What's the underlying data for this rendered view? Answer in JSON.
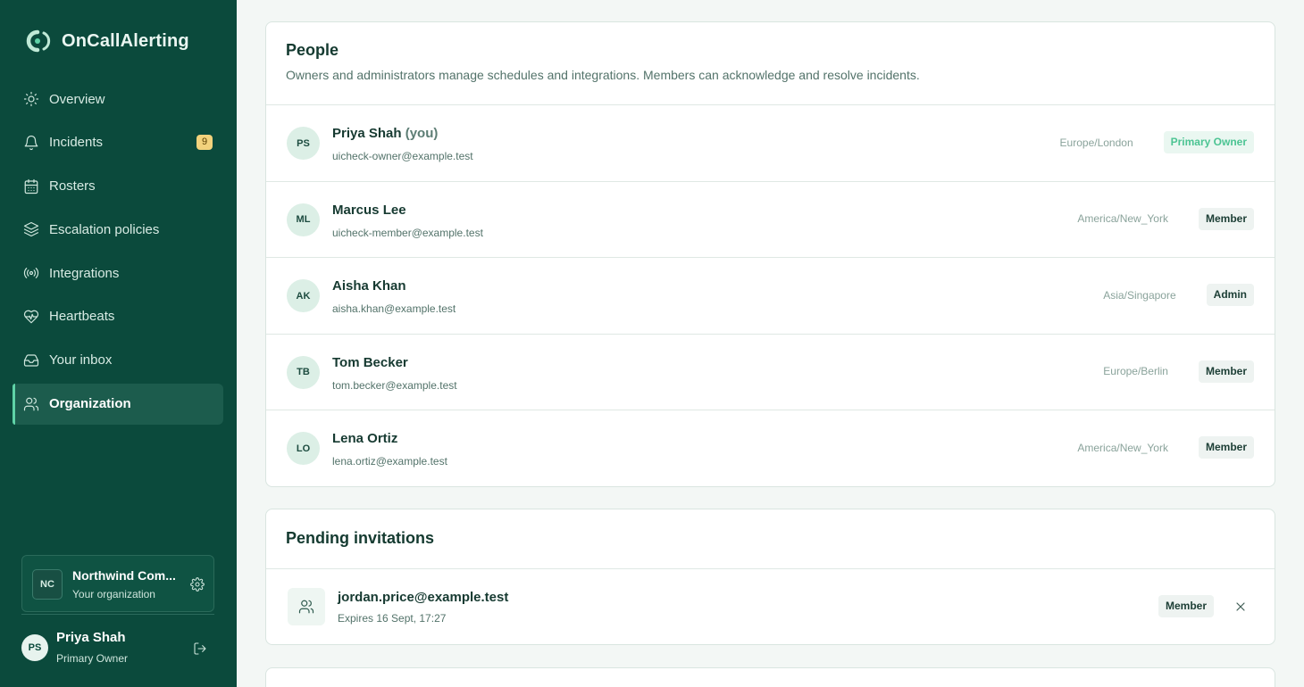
{
  "brand": {
    "name": "OnCallAlerting",
    "accent": "#5fd3a7"
  },
  "sidebar": {
    "items": [
      {
        "label": "Overview",
        "icon": "sun-icon"
      },
      {
        "label": "Incidents",
        "icon": "bell-icon",
        "badge": "9"
      },
      {
        "label": "Rosters",
        "icon": "calendar-icon"
      },
      {
        "label": "Escalation policies",
        "icon": "layers-icon"
      },
      {
        "label": "Integrations",
        "icon": "broadcast-icon"
      },
      {
        "label": "Heartbeats",
        "icon": "heartbeat-icon"
      },
      {
        "label": "Your inbox",
        "icon": "inbox-icon"
      },
      {
        "label": "Organization",
        "icon": "users-icon",
        "active": true
      }
    ],
    "org": {
      "initials": "NC",
      "name": "Northwind Com...",
      "subtitle": "Your organization"
    },
    "user": {
      "initials": "PS",
      "name": "Priya Shah",
      "role": "Primary Owner"
    }
  },
  "people": {
    "title": "People",
    "description": "Owners and administrators manage schedules and integrations. Members can acknowledge and resolve incidents.",
    "members": [
      {
        "initials": "PS",
        "name": "Priya Shah",
        "you": "(you)",
        "email": "uicheck-owner@example.test",
        "timezone": "Europe/London",
        "role": "Primary Owner"
      },
      {
        "initials": "ML",
        "name": "Marcus Lee",
        "email": "uicheck-member@example.test",
        "timezone": "America/New_York",
        "role": "Member"
      },
      {
        "initials": "AK",
        "name": "Aisha Khan",
        "email": "aisha.khan@example.test",
        "timezone": "Asia/Singapore",
        "role": "Admin"
      },
      {
        "initials": "TB",
        "name": "Tom Becker",
        "email": "tom.becker@example.test",
        "timezone": "Europe/Berlin",
        "role": "Member"
      },
      {
        "initials": "LO",
        "name": "Lena Ortiz",
        "email": "lena.ortiz@example.test",
        "timezone": "America/New_York",
        "role": "Member"
      }
    ]
  },
  "invitations": {
    "title": "Pending invitations",
    "items": [
      {
        "email": "jordan.price@example.test",
        "expires": "Expires 16 Sept, 17:27",
        "role": "Member"
      }
    ]
  }
}
